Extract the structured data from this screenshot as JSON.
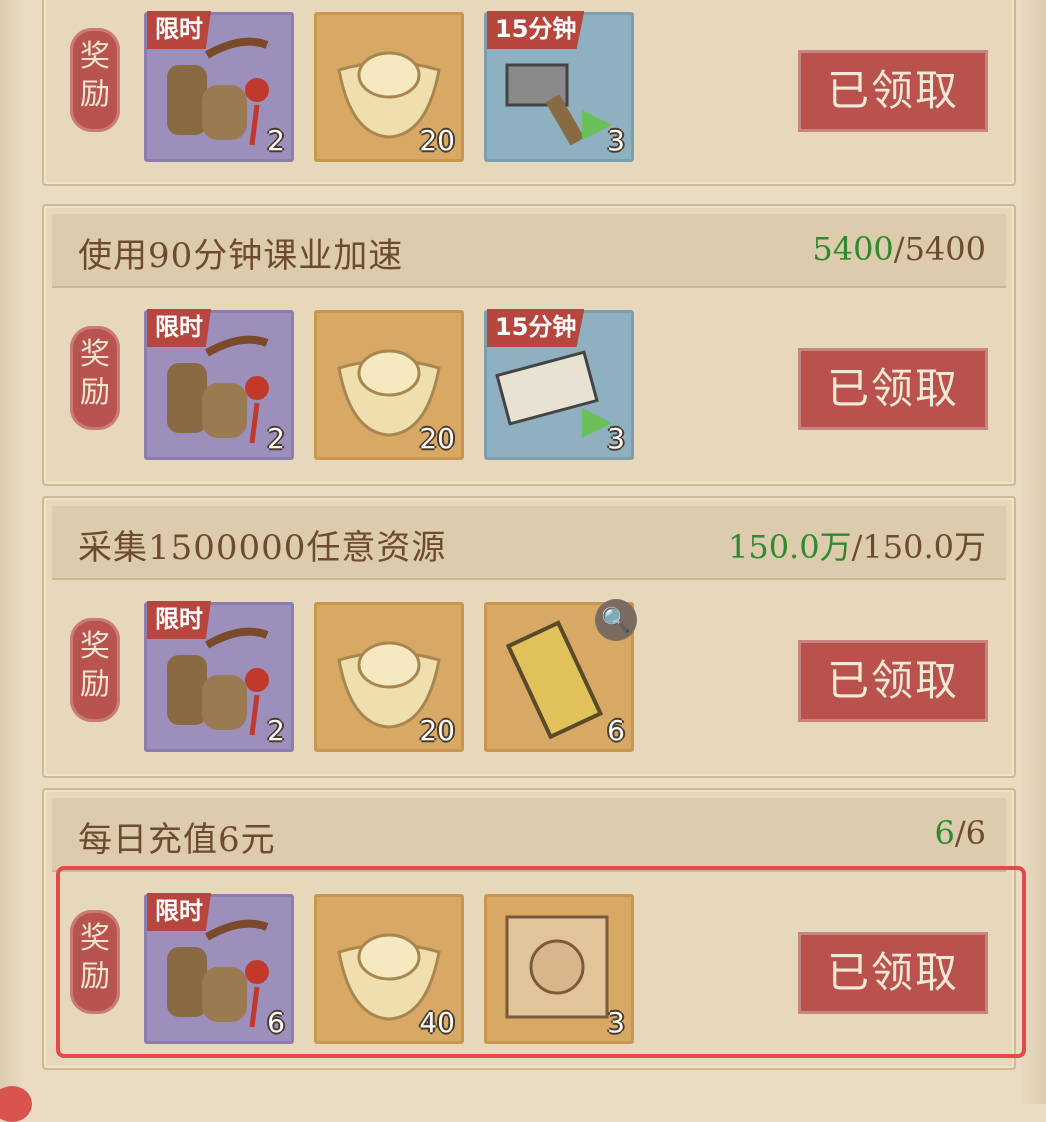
{
  "tasks": [
    {
      "title": "",
      "progress_current": "",
      "progress_total": "",
      "rewards": [
        {
          "icon": "pipe-charm-icon",
          "tag": "限时",
          "count": "2"
        },
        {
          "icon": "gold-ingot-icon",
          "tag": "",
          "count": "20"
        },
        {
          "icon": "hammer-speedup-icon",
          "tag": "15分钟",
          "count": "3"
        }
      ],
      "status": "已领取"
    },
    {
      "title": "使用90分钟课业加速",
      "progress_current": "5400",
      "progress_total": "/5400",
      "rewards": [
        {
          "icon": "pipe-charm-icon",
          "tag": "限时",
          "count": "2"
        },
        {
          "icon": "gold-ingot-icon",
          "tag": "",
          "count": "20"
        },
        {
          "icon": "scroll-speedup-icon",
          "tag": "15分钟",
          "count": "3"
        }
      ],
      "status": "已领取"
    },
    {
      "title": "采集1500000任意资源",
      "progress_current": "150.0万",
      "progress_total": "/150.0万",
      "rewards": [
        {
          "icon": "pipe-charm-icon",
          "tag": "限时",
          "count": "2"
        },
        {
          "icon": "gold-ingot-icon",
          "tag": "",
          "count": "20"
        },
        {
          "icon": "golden-token-icon",
          "tag": "",
          "count": "6"
        }
      ],
      "status": "已领取"
    },
    {
      "title": "每日充值6元",
      "progress_current": "6",
      "progress_total": "/6",
      "rewards": [
        {
          "icon": "pipe-charm-icon",
          "tag": "限时",
          "count": "6"
        },
        {
          "icon": "gold-ingot-icon",
          "tag": "",
          "count": "40"
        },
        {
          "icon": "general-portrait-icon",
          "tag": "",
          "count": "3"
        }
      ],
      "status": "已领取"
    }
  ],
  "reward_label": "奖励"
}
